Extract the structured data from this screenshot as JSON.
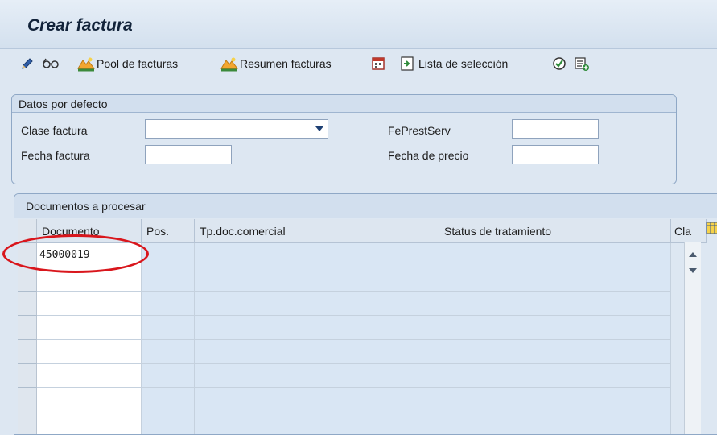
{
  "window": {
    "title": "Crear factura"
  },
  "toolbar": {
    "pool_label": "Pool de facturas",
    "resumen_label": "Resumen facturas",
    "lista_label": "Lista de selección"
  },
  "defaults": {
    "heading": "Datos por defecto",
    "clase_factura_label": "Clase factura",
    "clase_factura_value": "",
    "fecha_factura_label": "Fecha factura",
    "fecha_factura_value": "",
    "feprestserv_label": "FePrestServ",
    "feprestserv_value": "",
    "fecha_precio_label": "Fecha de precio",
    "fecha_precio_value": ""
  },
  "docs": {
    "heading": "Documentos a procesar",
    "columns": [
      "Documento",
      "Pos.",
      "Tp.doc.comercial",
      "Status de tratamiento",
      "Cla"
    ],
    "rows": [
      [
        "45000019",
        "",
        "",
        ""
      ],
      [
        "",
        "",
        "",
        ""
      ],
      [
        "",
        "",
        "",
        ""
      ],
      [
        "",
        "",
        "",
        ""
      ],
      [
        "",
        "",
        "",
        ""
      ],
      [
        "",
        "",
        "",
        ""
      ],
      [
        "",
        "",
        "",
        ""
      ],
      [
        "",
        "",
        "",
        ""
      ]
    ]
  },
  "colors": {
    "background": "#dde7f2",
    "editable_cell": "#ffffff",
    "readonly_cell": "#d9e6f4",
    "highlight": "#d9161c"
  },
  "icons": [
    "pencil-icon",
    "glasses-icon",
    "pool-icon",
    "resumen-icon",
    "calendar-icon",
    "lista-icon",
    "execute-icon",
    "add-list-icon",
    "grid-config-icon"
  ]
}
